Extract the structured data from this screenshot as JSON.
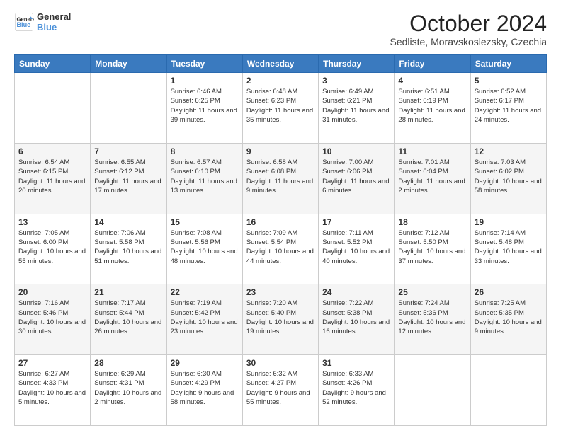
{
  "header": {
    "logo": {
      "line1": "General",
      "line2": "Blue",
      "icon_color": "#4a90d9"
    },
    "title": "October 2024",
    "subtitle": "Sedliste, Moravskoslezsky, Czechia"
  },
  "calendar": {
    "days_of_week": [
      "Sunday",
      "Monday",
      "Tuesday",
      "Wednesday",
      "Thursday",
      "Friday",
      "Saturday"
    ],
    "weeks": [
      [
        {
          "day": "",
          "sunrise": "",
          "sunset": "",
          "daylight": ""
        },
        {
          "day": "",
          "sunrise": "",
          "sunset": "",
          "daylight": ""
        },
        {
          "day": "1",
          "sunrise": "Sunrise: 6:46 AM",
          "sunset": "Sunset: 6:25 PM",
          "daylight": "Daylight: 11 hours and 39 minutes."
        },
        {
          "day": "2",
          "sunrise": "Sunrise: 6:48 AM",
          "sunset": "Sunset: 6:23 PM",
          "daylight": "Daylight: 11 hours and 35 minutes."
        },
        {
          "day": "3",
          "sunrise": "Sunrise: 6:49 AM",
          "sunset": "Sunset: 6:21 PM",
          "daylight": "Daylight: 11 hours and 31 minutes."
        },
        {
          "day": "4",
          "sunrise": "Sunrise: 6:51 AM",
          "sunset": "Sunset: 6:19 PM",
          "daylight": "Daylight: 11 hours and 28 minutes."
        },
        {
          "day": "5",
          "sunrise": "Sunrise: 6:52 AM",
          "sunset": "Sunset: 6:17 PM",
          "daylight": "Daylight: 11 hours and 24 minutes."
        }
      ],
      [
        {
          "day": "6",
          "sunrise": "Sunrise: 6:54 AM",
          "sunset": "Sunset: 6:15 PM",
          "daylight": "Daylight: 11 hours and 20 minutes."
        },
        {
          "day": "7",
          "sunrise": "Sunrise: 6:55 AM",
          "sunset": "Sunset: 6:12 PM",
          "daylight": "Daylight: 11 hours and 17 minutes."
        },
        {
          "day": "8",
          "sunrise": "Sunrise: 6:57 AM",
          "sunset": "Sunset: 6:10 PM",
          "daylight": "Daylight: 11 hours and 13 minutes."
        },
        {
          "day": "9",
          "sunrise": "Sunrise: 6:58 AM",
          "sunset": "Sunset: 6:08 PM",
          "daylight": "Daylight: 11 hours and 9 minutes."
        },
        {
          "day": "10",
          "sunrise": "Sunrise: 7:00 AM",
          "sunset": "Sunset: 6:06 PM",
          "daylight": "Daylight: 11 hours and 6 minutes."
        },
        {
          "day": "11",
          "sunrise": "Sunrise: 7:01 AM",
          "sunset": "Sunset: 6:04 PM",
          "daylight": "Daylight: 11 hours and 2 minutes."
        },
        {
          "day": "12",
          "sunrise": "Sunrise: 7:03 AM",
          "sunset": "Sunset: 6:02 PM",
          "daylight": "Daylight: 10 hours and 58 minutes."
        }
      ],
      [
        {
          "day": "13",
          "sunrise": "Sunrise: 7:05 AM",
          "sunset": "Sunset: 6:00 PM",
          "daylight": "Daylight: 10 hours and 55 minutes."
        },
        {
          "day": "14",
          "sunrise": "Sunrise: 7:06 AM",
          "sunset": "Sunset: 5:58 PM",
          "daylight": "Daylight: 10 hours and 51 minutes."
        },
        {
          "day": "15",
          "sunrise": "Sunrise: 7:08 AM",
          "sunset": "Sunset: 5:56 PM",
          "daylight": "Daylight: 10 hours and 48 minutes."
        },
        {
          "day": "16",
          "sunrise": "Sunrise: 7:09 AM",
          "sunset": "Sunset: 5:54 PM",
          "daylight": "Daylight: 10 hours and 44 minutes."
        },
        {
          "day": "17",
          "sunrise": "Sunrise: 7:11 AM",
          "sunset": "Sunset: 5:52 PM",
          "daylight": "Daylight: 10 hours and 40 minutes."
        },
        {
          "day": "18",
          "sunrise": "Sunrise: 7:12 AM",
          "sunset": "Sunset: 5:50 PM",
          "daylight": "Daylight: 10 hours and 37 minutes."
        },
        {
          "day": "19",
          "sunrise": "Sunrise: 7:14 AM",
          "sunset": "Sunset: 5:48 PM",
          "daylight": "Daylight: 10 hours and 33 minutes."
        }
      ],
      [
        {
          "day": "20",
          "sunrise": "Sunrise: 7:16 AM",
          "sunset": "Sunset: 5:46 PM",
          "daylight": "Daylight: 10 hours and 30 minutes."
        },
        {
          "day": "21",
          "sunrise": "Sunrise: 7:17 AM",
          "sunset": "Sunset: 5:44 PM",
          "daylight": "Daylight: 10 hours and 26 minutes."
        },
        {
          "day": "22",
          "sunrise": "Sunrise: 7:19 AM",
          "sunset": "Sunset: 5:42 PM",
          "daylight": "Daylight: 10 hours and 23 minutes."
        },
        {
          "day": "23",
          "sunrise": "Sunrise: 7:20 AM",
          "sunset": "Sunset: 5:40 PM",
          "daylight": "Daylight: 10 hours and 19 minutes."
        },
        {
          "day": "24",
          "sunrise": "Sunrise: 7:22 AM",
          "sunset": "Sunset: 5:38 PM",
          "daylight": "Daylight: 10 hours and 16 minutes."
        },
        {
          "day": "25",
          "sunrise": "Sunrise: 7:24 AM",
          "sunset": "Sunset: 5:36 PM",
          "daylight": "Daylight: 10 hours and 12 minutes."
        },
        {
          "day": "26",
          "sunrise": "Sunrise: 7:25 AM",
          "sunset": "Sunset: 5:35 PM",
          "daylight": "Daylight: 10 hours and 9 minutes."
        }
      ],
      [
        {
          "day": "27",
          "sunrise": "Sunrise: 6:27 AM",
          "sunset": "Sunset: 4:33 PM",
          "daylight": "Daylight: 10 hours and 5 minutes."
        },
        {
          "day": "28",
          "sunrise": "Sunrise: 6:29 AM",
          "sunset": "Sunset: 4:31 PM",
          "daylight": "Daylight: 10 hours and 2 minutes."
        },
        {
          "day": "29",
          "sunrise": "Sunrise: 6:30 AM",
          "sunset": "Sunset: 4:29 PM",
          "daylight": "Daylight: 9 hours and 58 minutes."
        },
        {
          "day": "30",
          "sunrise": "Sunrise: 6:32 AM",
          "sunset": "Sunset: 4:27 PM",
          "daylight": "Daylight: 9 hours and 55 minutes."
        },
        {
          "day": "31",
          "sunrise": "Sunrise: 6:33 AM",
          "sunset": "Sunset: 4:26 PM",
          "daylight": "Daylight: 9 hours and 52 minutes."
        },
        {
          "day": "",
          "sunrise": "",
          "sunset": "",
          "daylight": ""
        },
        {
          "day": "",
          "sunrise": "",
          "sunset": "",
          "daylight": ""
        }
      ]
    ]
  }
}
